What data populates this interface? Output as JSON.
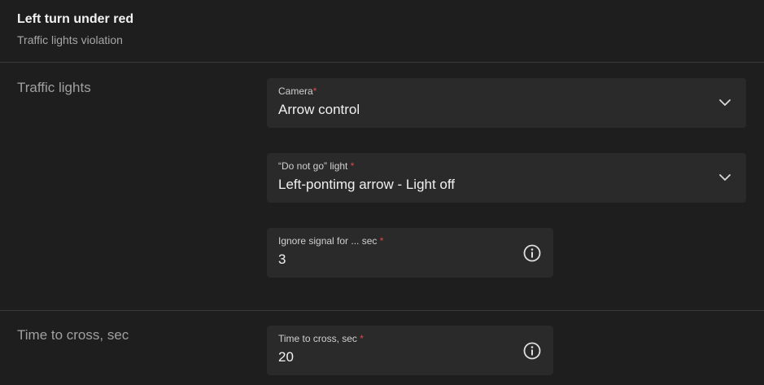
{
  "header": {
    "title": "Left turn under red",
    "subtitle": "Traffic lights violation"
  },
  "traffic_lights": {
    "section_label": "Traffic lights",
    "camera": {
      "label": "Camera",
      "required_mark": "*",
      "value": "Arrow control",
      "icon": "chevron-down-icon"
    },
    "do_not_go_light": {
      "label": "“Do not go” light ",
      "required_mark": "*",
      "value": "Left-pontimg arrow - Light off",
      "icon": "chevron-down-icon"
    },
    "ignore_signal": {
      "label": "Ignore signal for ... sec ",
      "required_mark": "*",
      "value": "3",
      "icon": "info-icon"
    }
  },
  "time_to_cross": {
    "section_label": "Time to cross, sec",
    "field": {
      "label": "Time to cross, sec ",
      "required_mark": "*",
      "value": "20",
      "icon": "info-icon"
    }
  },
  "colors": {
    "background": "#1e1e1e",
    "field_background": "#2a2a2a",
    "required": "#e04848",
    "divider": "#3a3a3a"
  }
}
